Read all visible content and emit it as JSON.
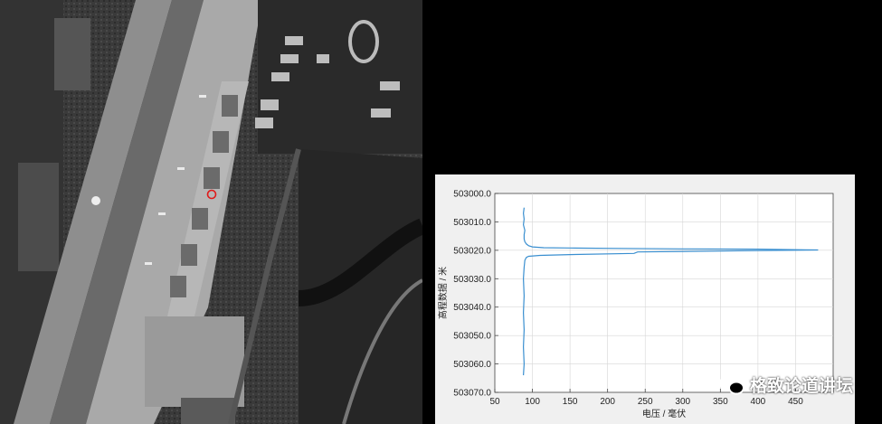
{
  "watermark": {
    "text": "格致论道讲坛",
    "icon": "wechat-icon"
  },
  "colors": {
    "series": "#3a8fd0",
    "marker": "#e01a1a"
  },
  "chart_data": {
    "type": "line",
    "title": "",
    "xlabel": "电压 / 毫伏",
    "ylabel": "高程数据 / 米",
    "xlim": [
      50,
      500
    ],
    "ylim": [
      503000.0,
      503070.0
    ],
    "y_inverted": true,
    "grid": true,
    "xticks": [
      "50",
      "100",
      "150",
      "200",
      "250",
      "300",
      "350",
      "400",
      "450"
    ],
    "yticks": [
      "503000.0",
      "503010.0",
      "503020.0",
      "503030.0",
      "503040.0",
      "503050.0",
      "503060.0",
      "503070.0"
    ],
    "series": [
      {
        "x": [
          89,
          88,
          89,
          88,
          90,
          89,
          89,
          90,
          92,
          95,
          100,
          115,
          150,
          200,
          300,
          400,
          480,
          400,
          300,
          240,
          235,
          150,
          110,
          95,
          92,
          90,
          89,
          88,
          89,
          88,
          89,
          88,
          89,
          88
        ],
        "y": [
          503005,
          503007,
          503009,
          503011,
          503013,
          503014.5,
          503016,
          503017,
          503017.8,
          503018.4,
          503018.8,
          503019.1,
          503019.2,
          503019.3,
          503019.5,
          503019.6,
          503019.9,
          503020.1,
          503020.4,
          503020.6,
          503021.1,
          503021.5,
          503021.8,
          503022.1,
          503022.5,
          503023.5,
          503026,
          503030,
          503036,
          503042,
          503048,
          503054,
          503060,
          503064
        ]
      }
    ]
  }
}
